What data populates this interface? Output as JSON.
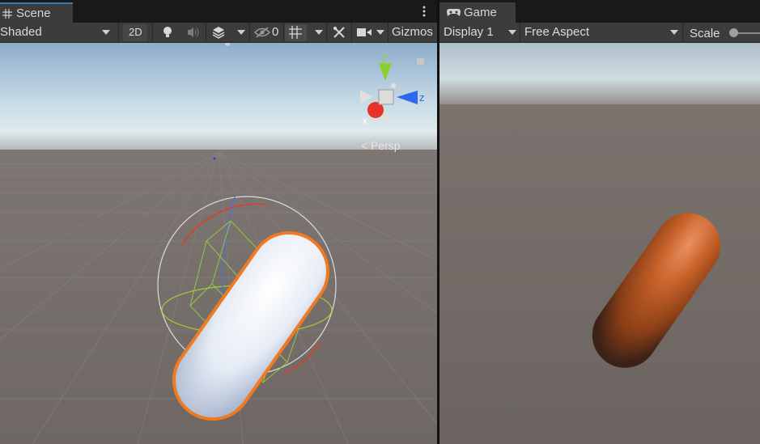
{
  "scene": {
    "tab_label": "Scene",
    "tab_icon": "grid-hash-icon",
    "menu_icon": "kebab-menu-icon",
    "shading_mode": "Shaded",
    "btn_2d": "2D",
    "hidden_count": "0",
    "gizmos_label": "Gizmos",
    "persp_label": "Persp",
    "axis_labels": {
      "y": "y",
      "z": "z",
      "x": "x"
    }
  },
  "game": {
    "tab_label": "Game",
    "tab_icon": "gamepad-icon",
    "display": "Display 1",
    "aspect": "Free Aspect",
    "scale_label": "Scale"
  },
  "colors": {
    "tab_accent": "#3a79bb",
    "selection_outline": "#f07a21",
    "capsule_game": "#c8622a",
    "axis_x": "#e8332a",
    "axis_y": "#8ad12f",
    "axis_z": "#3a6ef0"
  }
}
